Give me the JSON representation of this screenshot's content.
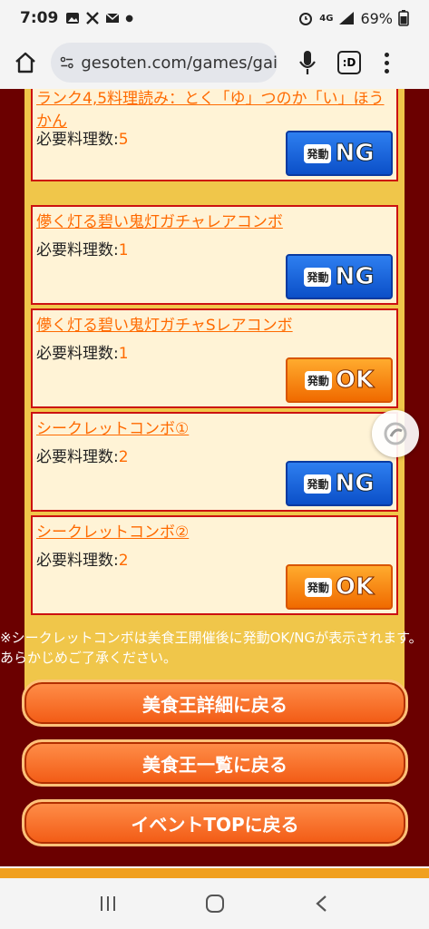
{
  "status_bar": {
    "time": "7:09",
    "network": "4G",
    "battery": "69%"
  },
  "browser": {
    "url": "gesoten.com/games/gai",
    "tabs_label": ":D"
  },
  "combos": [
    {
      "name": "ランク4,5料理読み：とく「ゆ」つのか「い」ほうかん",
      "req_label": "必要料理数:",
      "req_count": "5",
      "status_head": "発動",
      "status": "NG"
    },
    {
      "name": "儚く灯る碧い鬼灯ガチャレアコンボ",
      "req_label": "必要料理数:",
      "req_count": "1",
      "status_head": "発動",
      "status": "NG"
    },
    {
      "name": "儚く灯る碧い鬼灯ガチャSレアコンボ",
      "req_label": "必要料理数:",
      "req_count": "1",
      "status_head": "発動",
      "status": "OK"
    },
    {
      "name": "シークレットコンボ①",
      "req_label": "必要料理数:",
      "req_count": "2",
      "status_head": "発動",
      "status": "NG"
    },
    {
      "name": "シークレットコンボ②",
      "req_label": "必要料理数:",
      "req_count": "2",
      "status_head": "発動",
      "status": "OK"
    }
  ],
  "note": "※シークレットコンボは美食王開催後に発動OK/NGが表示されます。あらかじめご了承ください。",
  "buttons": {
    "detail": "美食王詳細に戻る",
    "list": "美食王一覧に戻る",
    "event_top": "イベントTOPに戻る"
  },
  "colors": {
    "page_bg": "#6b0000",
    "link_orange": "#ff6a00",
    "ng_blue": "#0b4fc8",
    "ok_orange": "#f06a00"
  }
}
